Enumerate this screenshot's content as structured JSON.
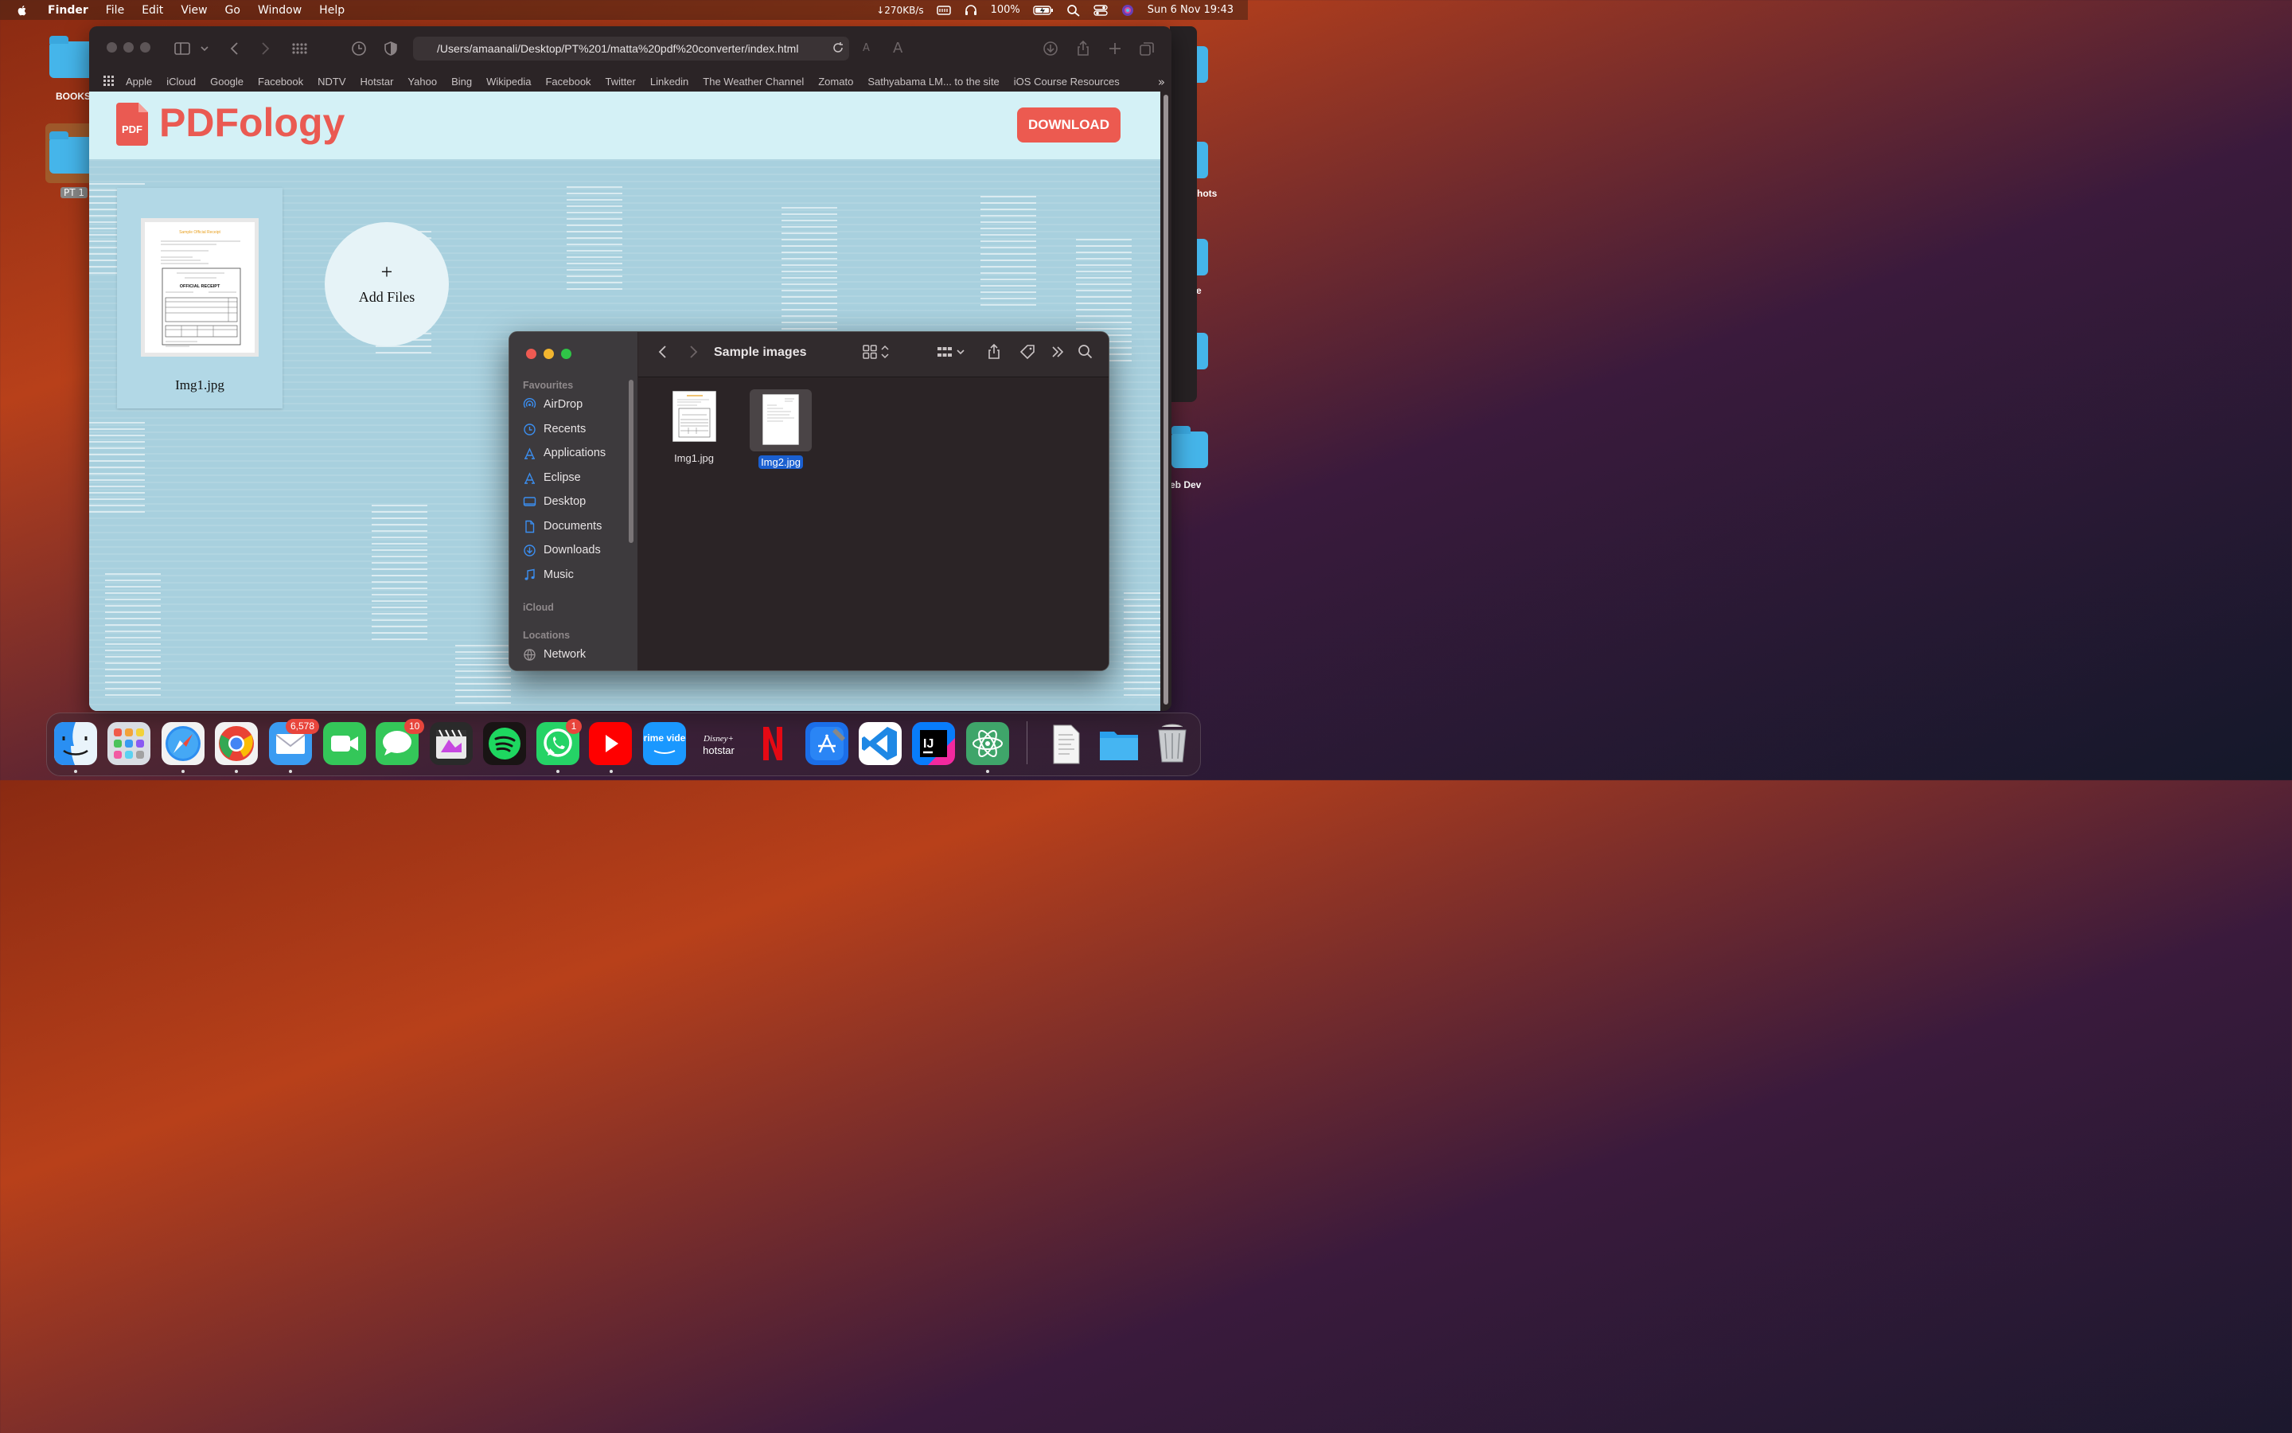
{
  "menubar": {
    "app_name": "Finder",
    "items": [
      "File",
      "Edit",
      "View",
      "Go",
      "Window",
      "Help"
    ],
    "net_speed": "↓270KB/s",
    "battery": "100%",
    "datetime": "Sun 6 Nov  19:43"
  },
  "desktop": {
    "folder1_label": "BOOKS",
    "folder2_label": "PT 1",
    "right_label1": "hots",
    "right_label2": "e",
    "right_label3": "eb Dev"
  },
  "browser": {
    "url": "/Users/amaanali/Desktop/PT%201/matta%20pdf%20converter/index.html",
    "favorites": [
      "Apple",
      "iCloud",
      "Google",
      "Facebook",
      "NDTV",
      "Hotstar",
      "Yahoo",
      "Bing",
      "Wikipedia",
      "Facebook",
      "Twitter",
      "Linkedin",
      "The Weather Channel",
      "Zomato",
      "Sathyabama LM... to the site",
      "iOS Course Resources"
    ]
  },
  "webpage": {
    "brand": "PDFology",
    "logo_text": "PDF",
    "download_label": "DOWNLOAD",
    "card_filename": "Img1.jpg",
    "add_files_plus": "+",
    "add_files_label": "Add Files",
    "doc_title": "Sample Official Receipt",
    "doc_heading": "OFFICIAL RECEIPT"
  },
  "finder": {
    "title": "Sample images",
    "sections": {
      "favourites": "Favourites",
      "icloud": "iCloud",
      "locations": "Locations"
    },
    "sidebar_items": [
      "AirDrop",
      "Recents",
      "Applications",
      "Eclipse",
      "Desktop",
      "Documents",
      "Downloads",
      "Music"
    ],
    "location_items": [
      "Network"
    ],
    "files": [
      {
        "name": "Img1.jpg",
        "selected": false
      },
      {
        "name": "Img2.jpg",
        "selected": true
      }
    ]
  },
  "dock": {
    "apps": [
      "finder-app",
      "launchpad-app",
      "safari-app",
      "chrome-app",
      "mail-app",
      "facetime-app",
      "messages-app",
      "final-cut-app",
      "spotify-app",
      "whatsapp-app",
      "youtube-app",
      "prime-video-app",
      "disney-hotstar-app",
      "netflix-app",
      "xcode-app",
      "vscode-app",
      "intellij-app",
      "atom-app",
      "document-stack",
      "folder-stack",
      "trash"
    ],
    "mail_badge": "6,578",
    "messages_badge": "10",
    "whatsapp_badge": "1",
    "prime_label": "prime video",
    "hotstar_label": "hotstar",
    "disney_label": "Disney+",
    "ij_label": "IJ"
  },
  "colors": {
    "brand_red": "#ea5a52",
    "header_bg": "#d4f1f6",
    "finder_selection": "#1a5fd0"
  }
}
